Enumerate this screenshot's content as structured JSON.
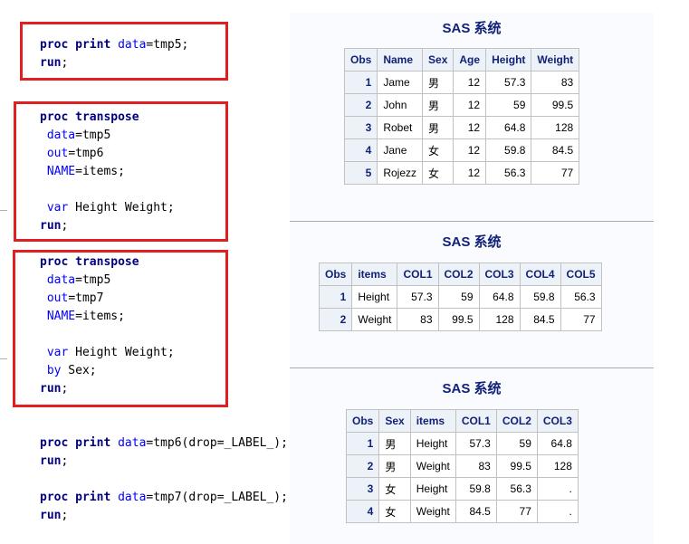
{
  "code_blocks": [
    {
      "lines": [
        [
          {
            "t": "proc print",
            "c": "kw"
          },
          {
            "t": " "
          },
          {
            "t": "data",
            "c": "op"
          },
          {
            "t": "=tmp5;"
          }
        ],
        [
          {
            "t": "run",
            "c": "kw"
          },
          {
            "t": ";"
          }
        ]
      ]
    },
    {
      "lines": [
        [
          {
            "t": "proc transpose",
            "c": "kw"
          }
        ],
        [
          {
            "t": " "
          },
          {
            "t": "data",
            "c": "op"
          },
          {
            "t": "=tmp5"
          }
        ],
        [
          {
            "t": " "
          },
          {
            "t": "out",
            "c": "op"
          },
          {
            "t": "=tmp6"
          }
        ],
        [
          {
            "t": " "
          },
          {
            "t": "NAME",
            "c": "op"
          },
          {
            "t": "=items;"
          }
        ],
        [],
        [
          {
            "t": " "
          },
          {
            "t": "var",
            "c": "op"
          },
          {
            "t": " Height Weight;"
          }
        ],
        [
          {
            "t": "run",
            "c": "kw"
          },
          {
            "t": ";"
          }
        ]
      ]
    },
    {
      "lines": [
        [
          {
            "t": "proc transpose",
            "c": "kw"
          }
        ],
        [
          {
            "t": " "
          },
          {
            "t": "data",
            "c": "op"
          },
          {
            "t": "=tmp5"
          }
        ],
        [
          {
            "t": " "
          },
          {
            "t": "out",
            "c": "op"
          },
          {
            "t": "=tmp7"
          }
        ],
        [
          {
            "t": " "
          },
          {
            "t": "NAME",
            "c": "op"
          },
          {
            "t": "=items;"
          }
        ],
        [],
        [
          {
            "t": " "
          },
          {
            "t": "var",
            "c": "op"
          },
          {
            "t": " Height Weight;"
          }
        ],
        [
          {
            "t": " "
          },
          {
            "t": "by",
            "c": "op"
          },
          {
            "t": " Sex;"
          }
        ],
        [
          {
            "t": "run",
            "c": "kw"
          },
          {
            "t": ";"
          }
        ]
      ]
    },
    {
      "lines": [
        [
          {
            "t": "proc print",
            "c": "kw"
          },
          {
            "t": " "
          },
          {
            "t": "data",
            "c": "op"
          },
          {
            "t": "=tmp6(drop=_LABEL_);"
          }
        ],
        [
          {
            "t": "run",
            "c": "kw"
          },
          {
            "t": ";"
          }
        ],
        [],
        [
          {
            "t": "proc print",
            "c": "kw"
          },
          {
            "t": " "
          },
          {
            "t": "data",
            "c": "op"
          },
          {
            "t": "=tmp7(drop=_LABEL_);"
          }
        ],
        [
          {
            "t": "run",
            "c": "kw"
          },
          {
            "t": ";"
          }
        ]
      ]
    }
  ],
  "outputs": [
    {
      "title": "SAS 系统",
      "columns": [
        "Obs",
        "Name",
        "Sex",
        "Age",
        "Height",
        "Weight"
      ],
      "align": [
        "obs",
        "txt",
        "txt",
        "num",
        "num",
        "num"
      ],
      "rows": [
        [
          "1",
          "Jame",
          "男",
          "12",
          "57.3",
          "83"
        ],
        [
          "2",
          "John",
          "男",
          "12",
          "59",
          "99.5"
        ],
        [
          "3",
          "Robet",
          "男",
          "12",
          "64.8",
          "128"
        ],
        [
          "4",
          "Jane",
          "女",
          "12",
          "59.8",
          "84.5"
        ],
        [
          "5",
          "Rojezz",
          "女",
          "12",
          "56.3",
          "77"
        ]
      ]
    },
    {
      "title": "SAS 系统",
      "columns": [
        "Obs",
        "items",
        "COL1",
        "COL2",
        "COL3",
        "COL4",
        "COL5"
      ],
      "align": [
        "obs",
        "txt",
        "num",
        "num",
        "num",
        "num",
        "num"
      ],
      "rows": [
        [
          "1",
          "Height",
          "57.3",
          "59",
          "64.8",
          "59.8",
          "56.3"
        ],
        [
          "2",
          "Weight",
          "83",
          "99.5",
          "128",
          "84.5",
          "77"
        ]
      ]
    },
    {
      "title": "SAS 系统",
      "columns": [
        "Obs",
        "Sex",
        "items",
        "COL1",
        "COL2",
        "COL3"
      ],
      "align": [
        "obs",
        "txt",
        "txt",
        "num",
        "num",
        "num"
      ],
      "rows": [
        [
          "1",
          "男",
          "Height",
          "57.3",
          "59",
          "64.8"
        ],
        [
          "2",
          "男",
          "Weight",
          "83",
          "99.5",
          "128"
        ],
        [
          "3",
          "女",
          "Height",
          "59.8",
          "56.3",
          "."
        ],
        [
          "4",
          "女",
          "Weight",
          "84.5",
          "77",
          "."
        ]
      ]
    }
  ],
  "colors": {
    "highlight_box": "#e02020",
    "keyword": "#000080",
    "option": "#0000ff",
    "table_header_bg": "#edf2f9",
    "table_header_text": "#112277"
  }
}
